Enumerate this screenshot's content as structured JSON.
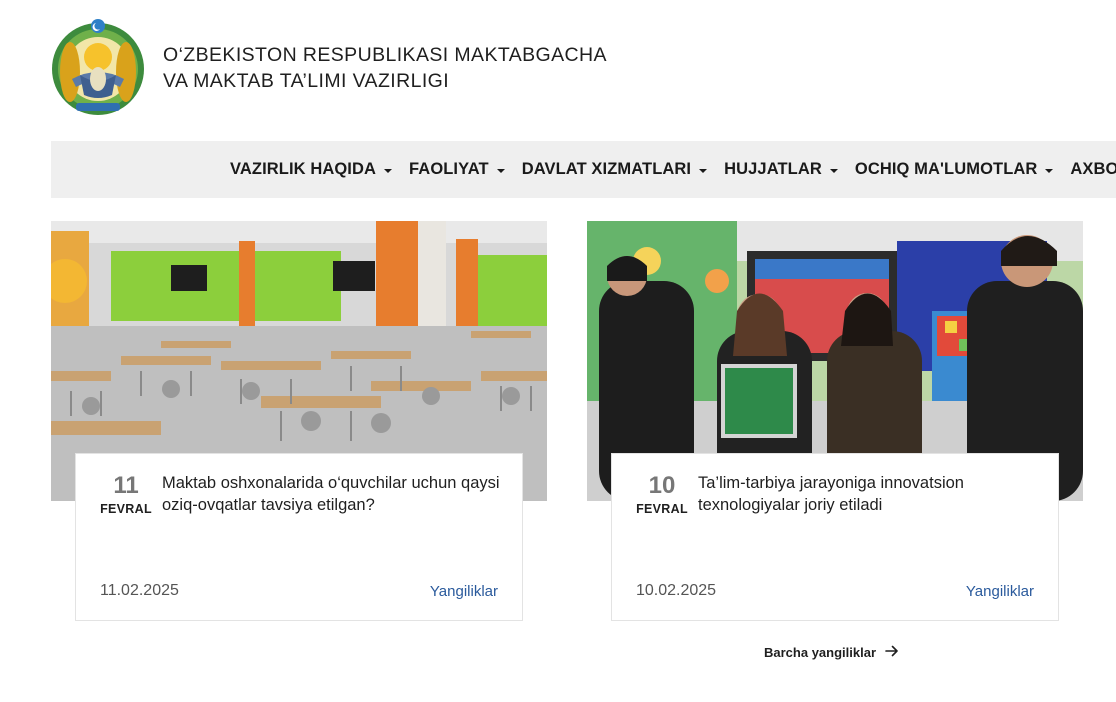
{
  "header": {
    "title_line1": "O‘ZBEKISTON RESPUBLIKASI MAKTABGACHA",
    "title_line2": "VA MAKTAB TA’LIMI VAZIRLIGI",
    "emblem_icon": "state-emblem-icon"
  },
  "nav": {
    "items": [
      {
        "label": "VAZIRLIK HAQIDA"
      },
      {
        "label": "FAOLIYAT"
      },
      {
        "label": "DAVLAT XIZMATLARI"
      },
      {
        "label": "HUJJATLAR"
      },
      {
        "label": "OCHIQ MA'LUMOTLAR"
      },
      {
        "label": "AXBO"
      }
    ]
  },
  "news": [
    {
      "day": "11",
      "month": "FEVRAL",
      "title": "Maktab oshxonalarida o‘quvchilar uchun qaysi oziq-ovqatlar tavsiya etilgan?",
      "date": "11.02.2025",
      "category": "Yangiliklar"
    },
    {
      "day": "10",
      "month": "FEVRAL",
      "title": "Ta’lim-tarbiya jarayoniga innovatsion texnologiyalar joriy etiladi",
      "date": "10.02.2025",
      "category": "Yangiliklar"
    }
  ],
  "all_news_label": "Barcha yangiliklar",
  "colors": {
    "nav_bg": "#efefef",
    "link": "#2a5a9c",
    "day": "#777777"
  }
}
